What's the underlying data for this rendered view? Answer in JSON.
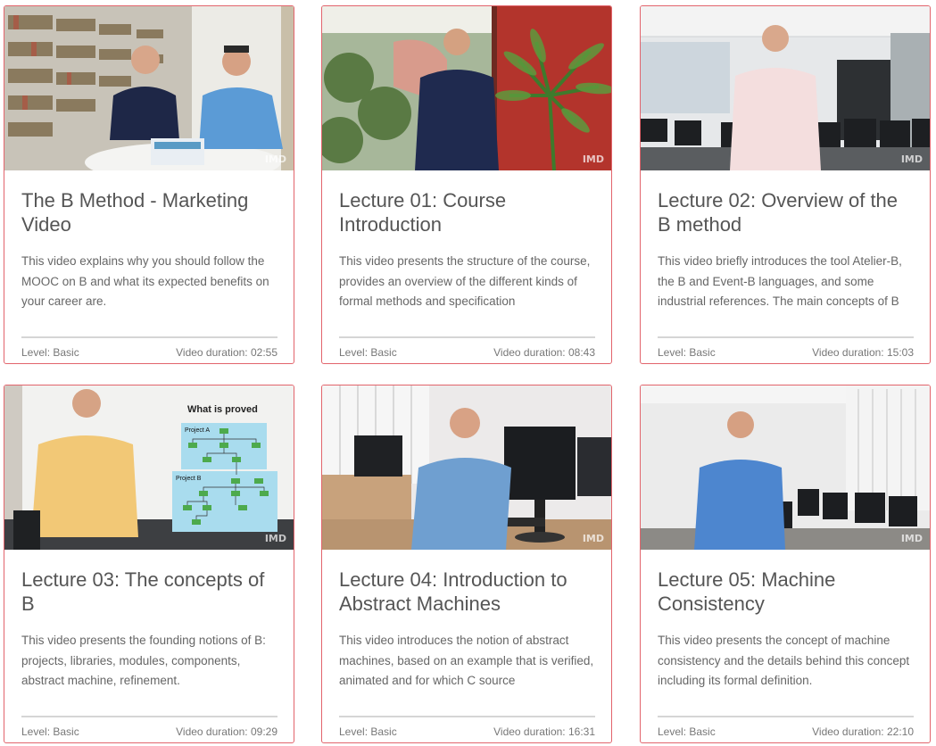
{
  "cards": [
    {
      "title": "The B Method - Marketing Video",
      "description": "This video explains why you should follow the MOOC on B and what its expected benefits on your career are.",
      "level": "Level: Basic",
      "duration": "Video duration: 02:55"
    },
    {
      "title": "Lecture 01: Course Introduction",
      "description": "This video presents the structure of the course, provides an overview of the different kinds of formal methods and specification",
      "level": "Level: Basic",
      "duration": "Video duration: 08:43"
    },
    {
      "title": "Lecture 02: Overview of the B method",
      "description": "This video briefly introduces the tool Atelier-B, the B and Event-B languages, and some industrial references. The main concepts of B",
      "level": "Level: Basic",
      "duration": "Video duration: 15:03"
    },
    {
      "title": "Lecture 03: The concepts of B",
      "description": "This video presents the founding notions of B: projects, libraries, modules, components, abstract machine, refinement.",
      "level": "Level: Basic",
      "duration": "Video duration: 09:29",
      "thumb_text": {
        "heading": "What is proved",
        "project_a": "Project A",
        "project_b": "Project B"
      }
    },
    {
      "title": "Lecture 04: Introduction to Abstract Machines",
      "description": "This video introduces the notion of abstract machines, based on an example that is verified, animated and for which C source",
      "level": "Level: Basic",
      "duration": "Video duration: 16:31"
    },
    {
      "title": "Lecture 05: Machine Consistency",
      "description": "This video presents the concept of machine consistency and the details behind this concept including its formal definition.",
      "level": "Level: Basic",
      "duration": "Video duration: 22:10"
    }
  ],
  "watermark": "IMD",
  "colors": {
    "card_border": "#e2646c",
    "title": "#555555",
    "text": "#666666"
  }
}
